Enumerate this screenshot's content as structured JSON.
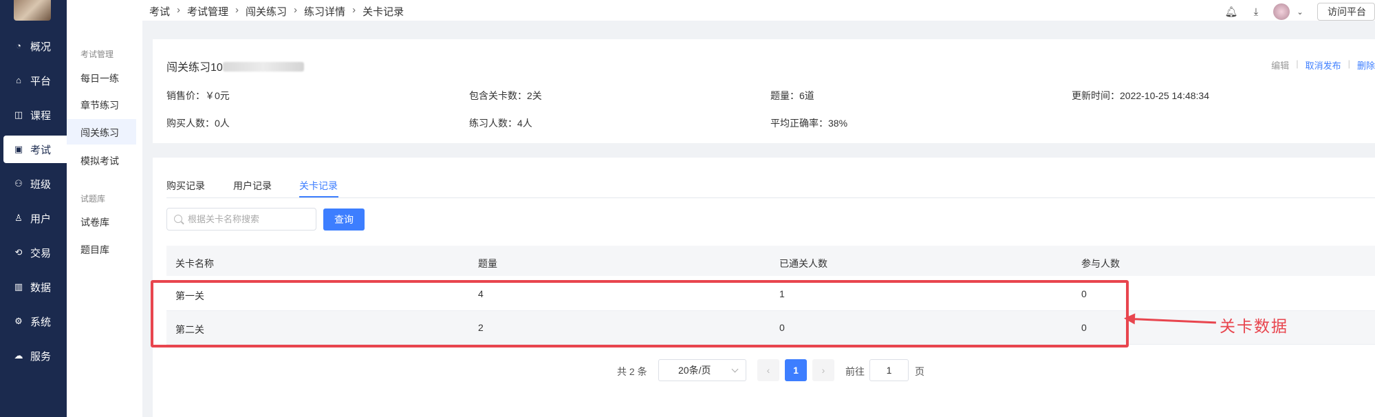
{
  "nav": {
    "items": [
      {
        "label": "概况",
        "icon": "clock-icon"
      },
      {
        "label": "平台",
        "icon": "shop-icon"
      },
      {
        "label": "课程",
        "icon": "book-icon"
      },
      {
        "label": "考试",
        "icon": "exam-icon"
      },
      {
        "label": "班级",
        "icon": "class-icon"
      },
      {
        "label": "用户",
        "icon": "user-icon"
      },
      {
        "label": "交易",
        "icon": "trade-icon"
      },
      {
        "label": "数据",
        "icon": "chart-icon"
      },
      {
        "label": "系统",
        "icon": "gear-icon"
      },
      {
        "label": "服务",
        "icon": "service-icon"
      }
    ],
    "active": "考试"
  },
  "subnav": {
    "group1": "考试管理",
    "items1": [
      "每日一练",
      "章节练习",
      "闯关练习",
      "模拟考试"
    ],
    "group2": "试题库",
    "items2": [
      "试卷库",
      "题目库"
    ],
    "active": "闯关练习"
  },
  "breadcrumb": [
    "考试",
    "考试管理",
    "闯关练习",
    "练习详情",
    "关卡记录"
  ],
  "header": {
    "visit": "访问平台"
  },
  "info": {
    "title_prefix": "闯关练习10",
    "actions": {
      "edit": "编辑",
      "unpublish": "取消发布",
      "delete": "删除"
    },
    "price": "销售价：￥0元",
    "levels": "包含关卡数：2关",
    "questions": "题量：6道",
    "updated": "更新时间：2022-10-25 14:48:34",
    "buyers": "购买人数：0人",
    "practicers": "练习人数：4人",
    "accuracy": "平均正确率：38%"
  },
  "tabs": [
    "购买记录",
    "用户记录",
    "关卡记录"
  ],
  "active_tab": "关卡记录",
  "search": {
    "placeholder": "根据关卡名称搜索",
    "button": "查询"
  },
  "table": {
    "headers": [
      "关卡名称",
      "题量",
      "已通关人数",
      "参与人数"
    ],
    "rows": [
      [
        "第一关",
        "4",
        "1",
        "0"
      ],
      [
        "第二关",
        "2",
        "0",
        "0"
      ]
    ]
  },
  "annotation": "关卡数据",
  "pagination": {
    "total": "共 2 条",
    "page_size": "20条/页",
    "current": "1",
    "goto_label": "前往",
    "goto_value": "1",
    "page_suffix": "页"
  }
}
